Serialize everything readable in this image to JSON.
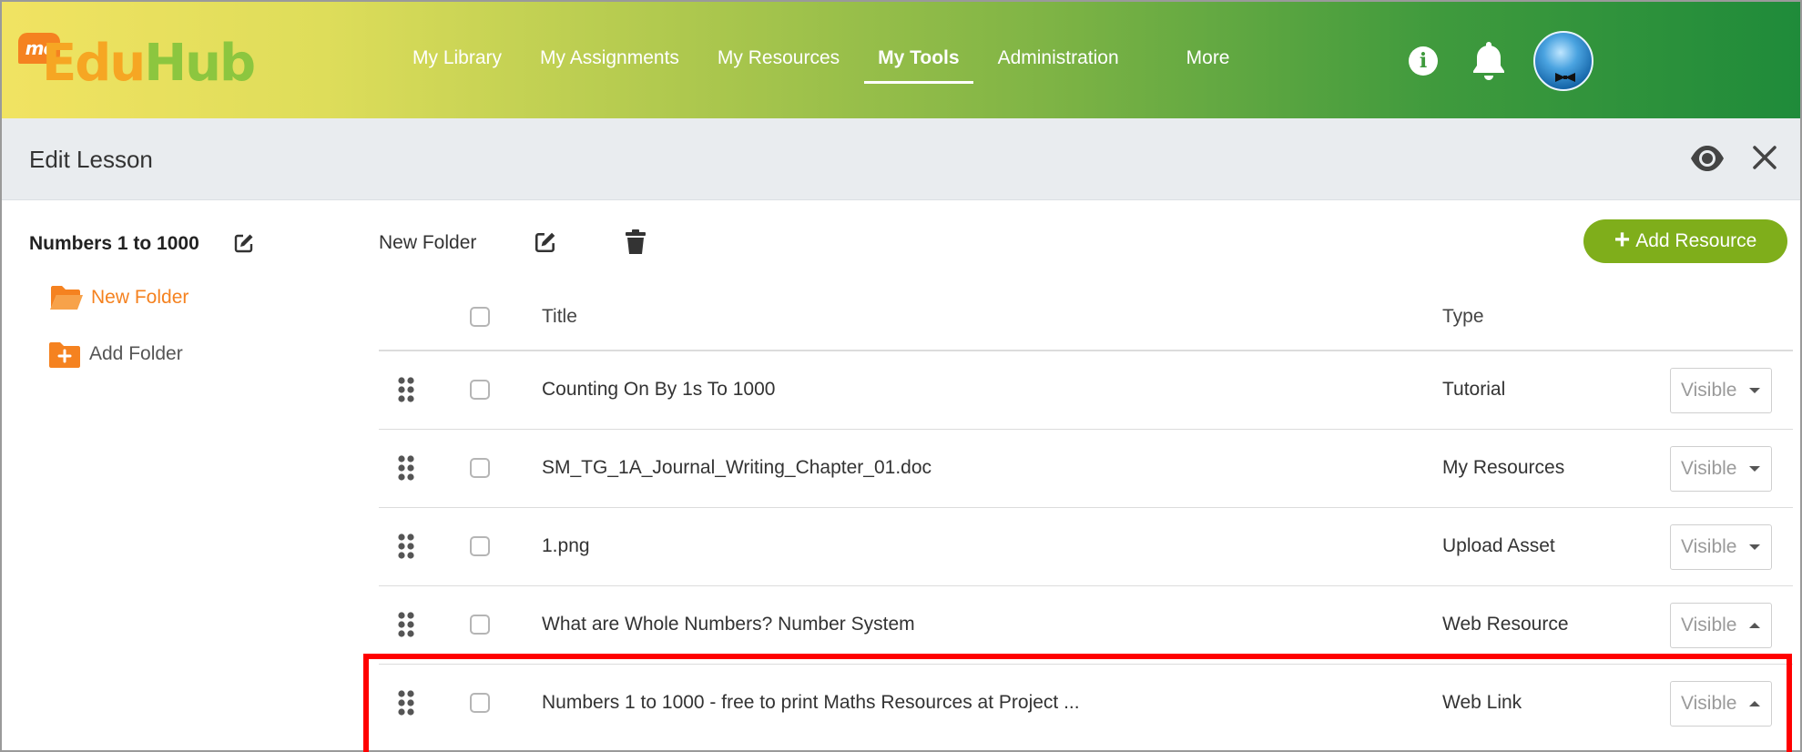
{
  "logo": {
    "badge": "mc",
    "part1": "Edu",
    "part2": "Hub"
  },
  "nav": {
    "items": [
      {
        "label": "My Library"
      },
      {
        "label": "My Assignments"
      },
      {
        "label": "My Resources"
      },
      {
        "label": "My Tools",
        "active": true
      },
      {
        "label": "Administration"
      },
      {
        "label": "More"
      }
    ],
    "icons": [
      "info-icon",
      "bell-icon",
      "avatar"
    ]
  },
  "subheader": {
    "title": "Edit Lesson",
    "icons": [
      "eye-icon",
      "close-icon"
    ]
  },
  "sidebar": {
    "lesson_title": "Numbers 1 to 1000",
    "folder_label": "New Folder",
    "add_folder_label": "Add Folder"
  },
  "toolbar": {
    "folder_name": "New Folder",
    "add_resource_label": "Add Resource",
    "add_resource_color": "#7fae1b"
  },
  "table": {
    "headers": {
      "title": "Title",
      "type": "Type"
    },
    "rows": [
      {
        "title": "Counting On By 1s To 1000",
        "type": "Tutorial",
        "visibility": "Visible",
        "caret": "down"
      },
      {
        "title": "SM_TG_1A_Journal_Writing_Chapter_01.doc",
        "type": "My Resources",
        "visibility": "Visible",
        "caret": "down"
      },
      {
        "title": "1.png",
        "type": "Upload Asset",
        "visibility": "Visible",
        "caret": "down"
      },
      {
        "title": "What are Whole Numbers? Number System",
        "type": "Web Resource",
        "visibility": "Visible",
        "caret": "up"
      },
      {
        "title": "Numbers 1 to 1000 - free to print Maths Resources at Project ...",
        "type": "Web Link",
        "visibility": "Visible",
        "caret": "up",
        "highlighted": true
      }
    ]
  },
  "colors": {
    "highlight": "#ff0000",
    "folder_accent": "#f58220"
  }
}
